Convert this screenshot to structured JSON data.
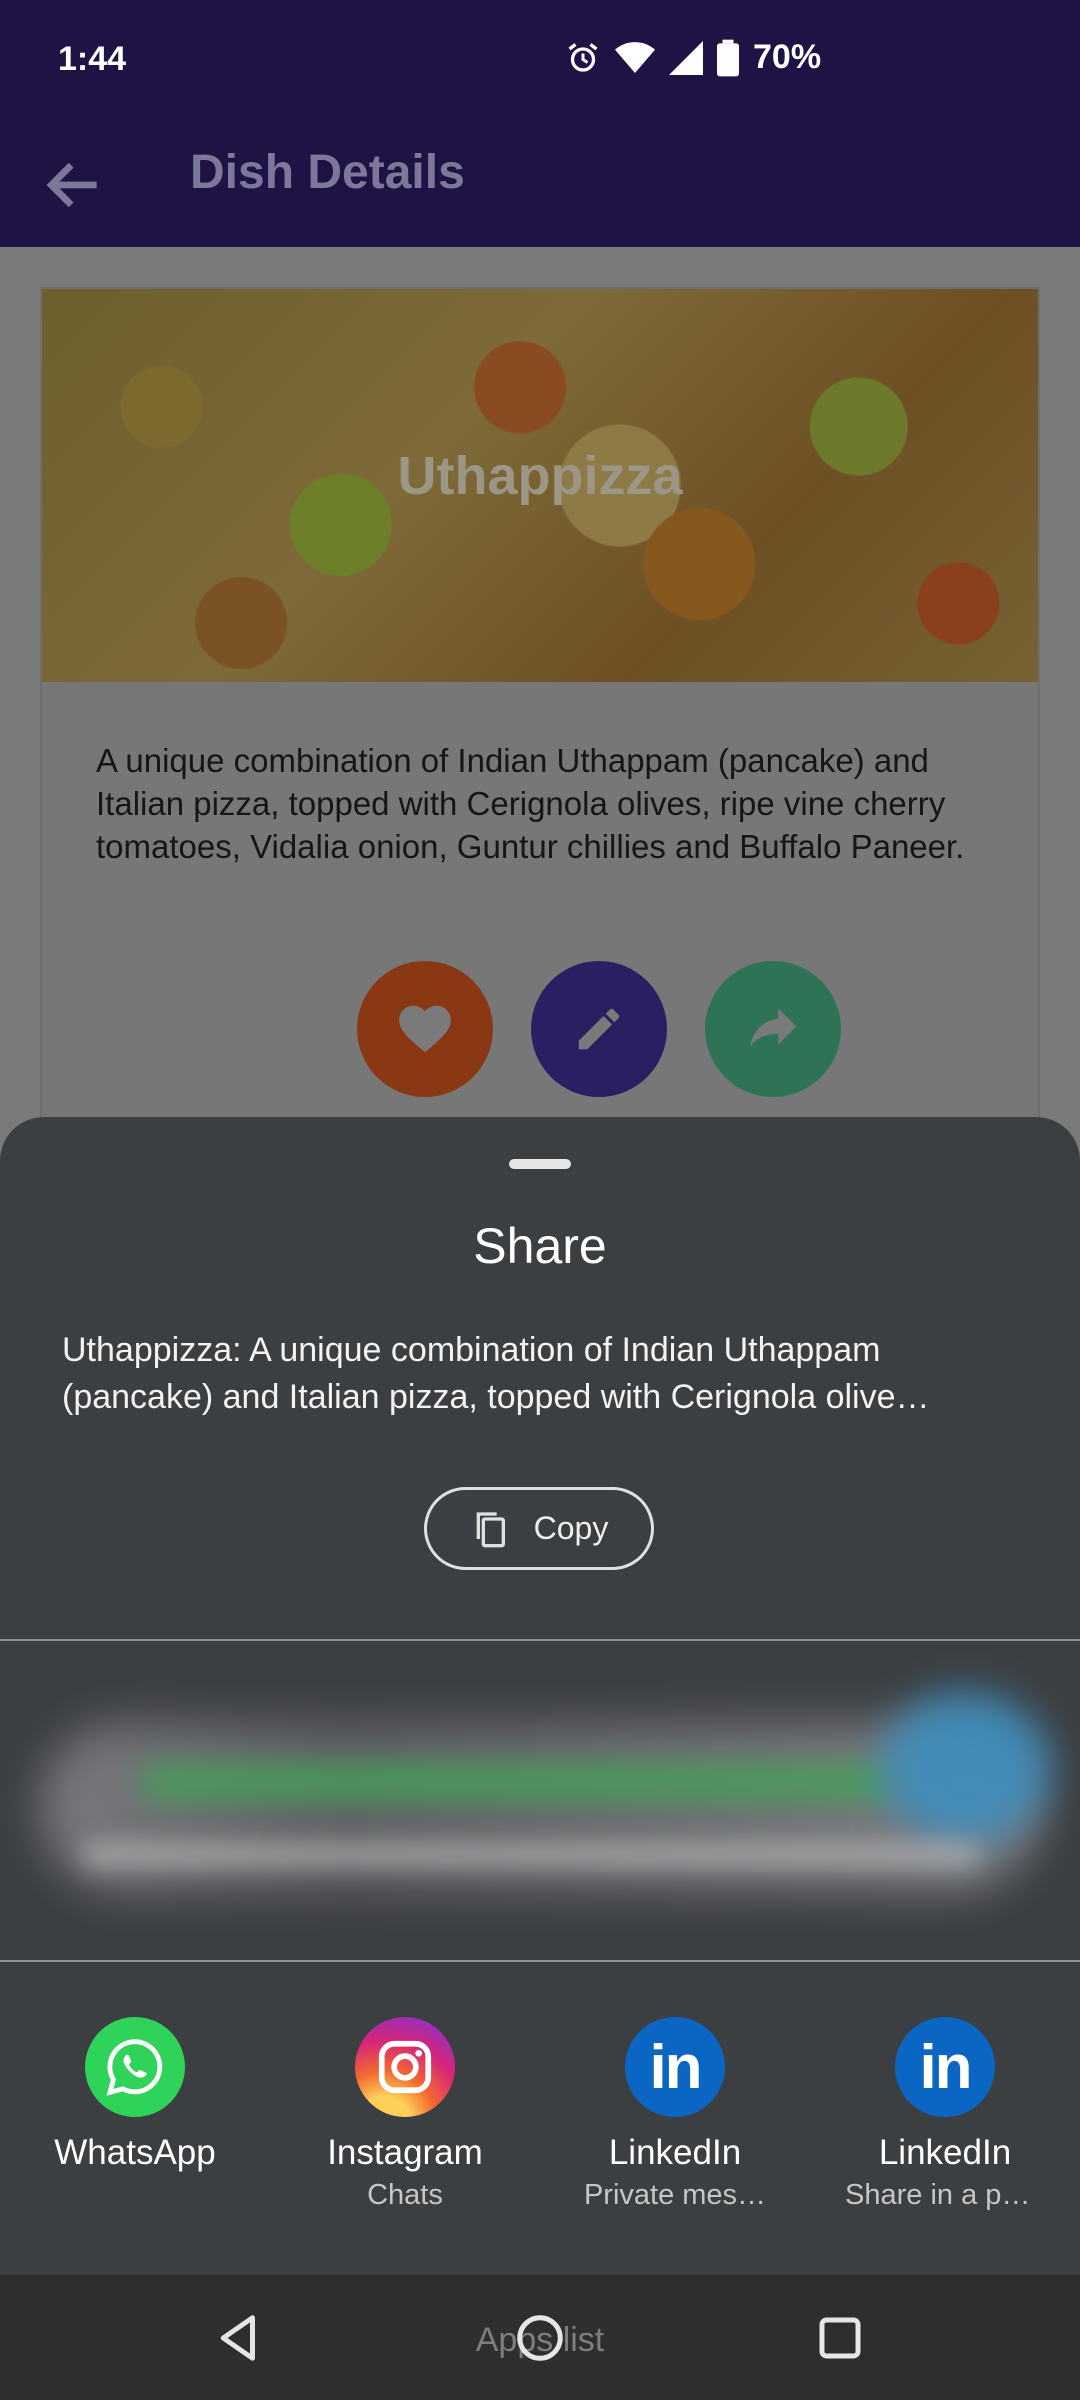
{
  "status_bar": {
    "time": "1:44",
    "battery": "70%",
    "icons": [
      "alarm-icon",
      "wifi-icon",
      "signal-icon",
      "battery-icon"
    ]
  },
  "app_bar": {
    "title": "Dish Details"
  },
  "dish": {
    "name": "Uthappizza",
    "description": "A unique combination of Indian Uthappam (pancake) and Italian pizza, topped with Cerignola olives, ripe vine cherry tomatoes, Vidalia onion, Guntur chillies and Buffalo Paneer."
  },
  "actions": {
    "favorite_icon": "heart-icon",
    "edit_icon": "pencil-icon",
    "share_icon": "share-arrow-icon",
    "colors": {
      "favorite": "#8a3814",
      "edit": "#2c1e63",
      "share": "#2f7356"
    }
  },
  "share_sheet": {
    "title": "Share",
    "preview_line1": "Uthappizza: A unique combination of Indian Uthappam",
    "preview_line2": "(pancake) and Italian pizza, topped with Cerignola olive…",
    "copy_label": "Copy",
    "apps": [
      {
        "label": "WhatsApp",
        "sub": ""
      },
      {
        "label": "Instagram",
        "sub": "Chats"
      },
      {
        "label": "LinkedIn",
        "sub": "Private mes…"
      },
      {
        "label": "LinkedIn",
        "sub": "Share in a po…"
      }
    ],
    "linkedin_logo_text": "in"
  },
  "nav_bar": {
    "overlay_text": "Apps list"
  }
}
